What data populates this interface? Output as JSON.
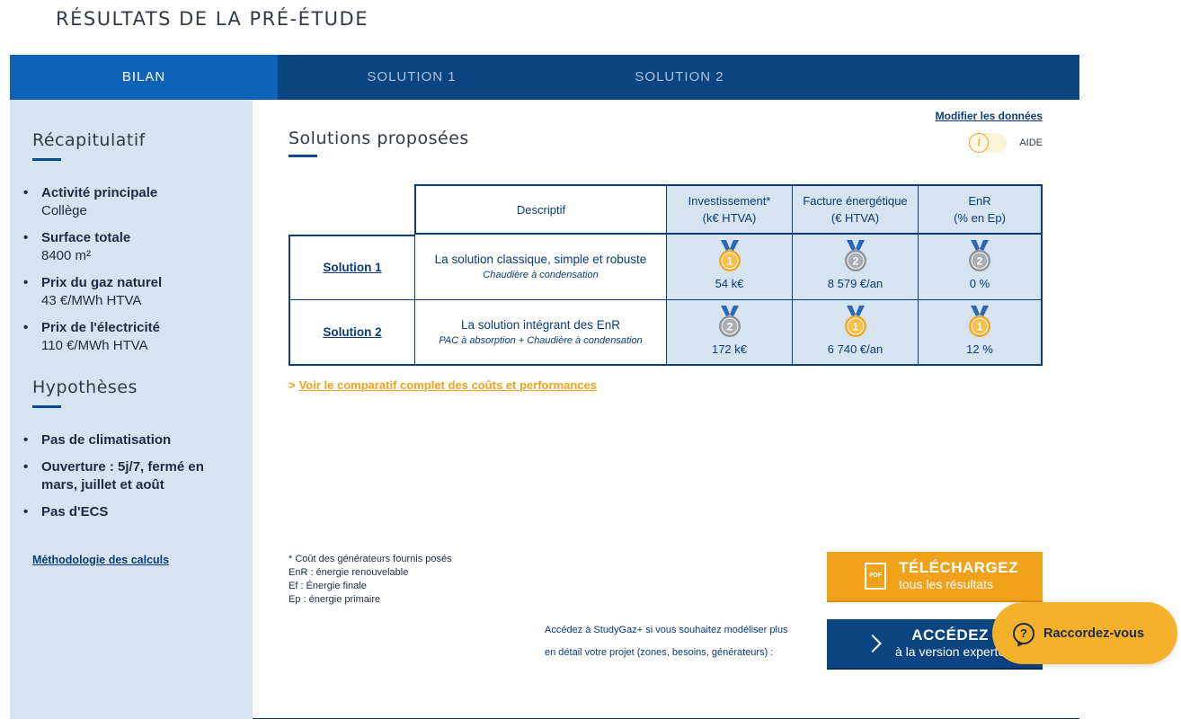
{
  "page_title": "RÉSULTATS DE LA PRÉ-ÉTUDE",
  "tabs": [
    {
      "label": "BILAN",
      "active": true
    },
    {
      "label": "SOLUTION 1",
      "active": false
    },
    {
      "label": "SOLUTION 2",
      "active": false
    }
  ],
  "sidebar": {
    "recap_heading": "Récapitulatif",
    "recap_items": [
      {
        "key": "Activité principale",
        "value": "Collège"
      },
      {
        "key": "Surface totale",
        "value": "8400 m²"
      },
      {
        "key": "Prix du gaz naturel",
        "value": "43 €/MWh HTVA"
      },
      {
        "key": "Prix de l'électricité",
        "value": "110 €/MWh HTVA"
      }
    ],
    "hypo_heading": "Hypothèses",
    "hypo_items": [
      "Pas de climatisation",
      "Ouverture : 5j/7, fermé en mars, juillet et août",
      "Pas d'ECS"
    ],
    "method_link": "Méthodologie des calculs"
  },
  "main": {
    "modify_link": "Modifier les données",
    "aide_label": "AIDE",
    "aide_icon": "i",
    "heading": "Solutions proposées",
    "table": {
      "headers": {
        "desc": "Descriptif",
        "invest_1": "Investissement*",
        "invest_2": "(k€ HTVA)",
        "facture_1": "Facture énergétique",
        "facture_2": "(€ HTVA)",
        "enr_1": "EnR",
        "enr_2": "(% en Ep)"
      },
      "rows": [
        {
          "name": "Solution 1",
          "title": "La solution classique, simple et robuste",
          "subtitle": "Chaudière à condensation",
          "invest": "54 k€",
          "invest_rank": "1",
          "facture": "8 579 €/an",
          "facture_rank": "2",
          "enr": "0 %",
          "enr_rank": "2"
        },
        {
          "name": "Solution 2",
          "title": "La solution intégrant des EnR",
          "subtitle": "PAC à absorption + Chaudière à condensation",
          "invest": "172 k€",
          "invest_rank": "2",
          "facture": "6 740 €/an",
          "facture_rank": "1",
          "enr": "12 %",
          "enr_rank": "1"
        }
      ]
    },
    "compare_prefix": ">",
    "compare_link": "Voir le comparatif complet des coûts et performances",
    "footnotes": [
      "* Coût des générateurs fournis posés",
      "EnR : énergie renouvelable",
      "Ef : Énergie finale",
      "Ep : énergie primaire"
    ],
    "download": {
      "icon_text": "PDF",
      "big": "TÉLÉCHARGEZ",
      "small": "tous les résultats"
    },
    "expert_intro_1": "Accédez à StudyGaz+ si vous souhaitez modéliser plus",
    "expert_intro_2": "en détail votre projet (zones, besoins, générateurs) :",
    "expert": {
      "big": "ACCÉDEZ",
      "small": "à la version experte"
    }
  },
  "chat": {
    "icon": "?",
    "label": "Raccordez-vous"
  },
  "colors": {
    "navy": "#0a4481",
    "active_tab": "#0d62b5",
    "sidebar_bg": "#d6e3f0",
    "orange": "#f0a21b",
    "gold_medal": "#f2a623",
    "silver_medal": "#8e939a"
  }
}
